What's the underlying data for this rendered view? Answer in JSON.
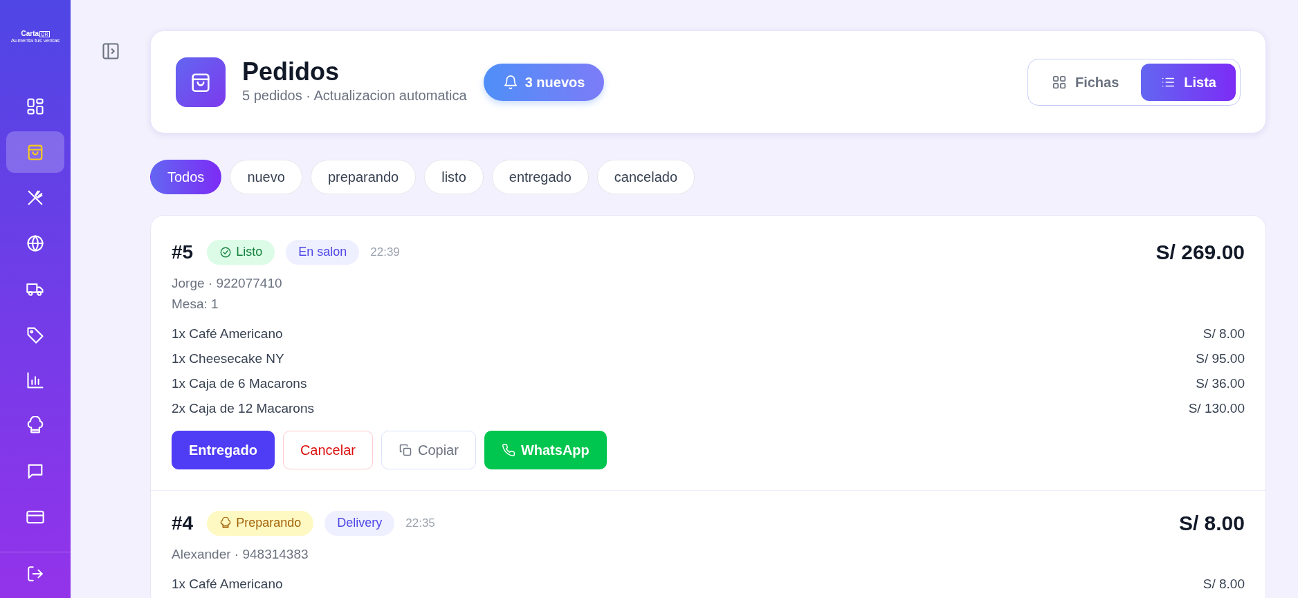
{
  "sidebar": {
    "logo": {
      "name": "Carta",
      "mark": "QR",
      "tagline": "Aumenta tus ventas"
    },
    "items": [
      {
        "selected": false
      },
      {
        "selected": true
      },
      {
        "selected": false
      },
      {
        "selected": false
      },
      {
        "selected": false
      },
      {
        "selected": false
      },
      {
        "selected": false
      },
      {
        "selected": false
      },
      {
        "selected": false
      },
      {
        "selected": false
      }
    ]
  },
  "header": {
    "title": "Pedidos",
    "subtitle": "5 pedidos · Actualizacion automatica",
    "alert": "3 nuevos",
    "views": [
      {
        "label": "Fichas",
        "selected": false
      },
      {
        "label": "Lista",
        "selected": true
      }
    ]
  },
  "filters": [
    {
      "label": "Todos",
      "selected": true
    },
    {
      "label": "nuevo",
      "selected": false
    },
    {
      "label": "preparando",
      "selected": false
    },
    {
      "label": "listo",
      "selected": false
    },
    {
      "label": "entregado",
      "selected": false
    },
    {
      "label": "cancelado",
      "selected": false
    }
  ],
  "orders": [
    {
      "number": "#5",
      "status": {
        "kind": "listo",
        "label": "Listo"
      },
      "type": "En salon",
      "time": "22:39",
      "total": "S/ 269.00",
      "customer": "Jorge · 922077410",
      "table": "Mesa: 1",
      "items": [
        {
          "name": "1x Café Americano",
          "price": "S/ 8.00"
        },
        {
          "name": "1x Cheesecake NY",
          "price": "S/ 95.00"
        },
        {
          "name": "1x Caja de 6 Macarons",
          "price": "S/ 36.00"
        },
        {
          "name": "2x Caja de 12 Macarons",
          "price": "S/ 130.00"
        }
      ],
      "actions": [
        {
          "kind": "primary",
          "label": "Entregado"
        },
        {
          "kind": "danger",
          "label": "Cancelar"
        },
        {
          "kind": "copy",
          "label": "Copiar"
        },
        {
          "kind": "whatsapp",
          "label": "WhatsApp"
        }
      ]
    },
    {
      "number": "#4",
      "status": {
        "kind": "preparando",
        "label": "Preparando"
      },
      "type": "Delivery",
      "time": "22:35",
      "total": "S/ 8.00",
      "customer": "Alexander · 948314383",
      "items": [
        {
          "name": "1x Café Americano",
          "price": "S/ 8.00"
        }
      ]
    }
  ]
}
